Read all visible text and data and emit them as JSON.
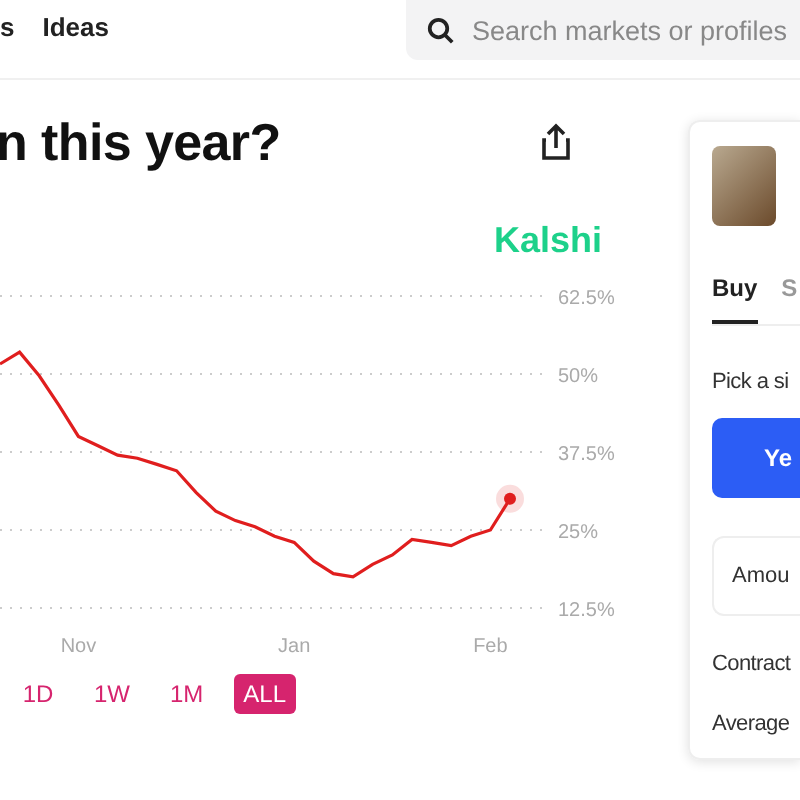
{
  "nav": {
    "items": [
      {
        "label": "s"
      },
      {
        "label": "Ideas"
      }
    ]
  },
  "search": {
    "placeholder": "Search markets or profiles"
  },
  "market": {
    "title": "n this year?",
    "source": "Kalshi",
    "chart_data": {
      "type": "line",
      "categories": [
        null,
        null,
        null,
        null,
        "Nov",
        null,
        null,
        null,
        null,
        null,
        null,
        null,
        null,
        null,
        null,
        "Jan",
        null,
        null,
        null,
        null,
        null,
        null,
        null,
        null,
        null,
        "Feb",
        null
      ],
      "series": [
        {
          "color": "#e01e1e",
          "values": [
            51.6,
            53.5,
            49.7,
            45,
            40,
            38.5,
            37,
            36.5,
            35.5,
            34.5,
            31,
            28,
            26.5,
            25.5,
            24,
            23,
            20,
            18,
            17.5,
            19.5,
            21,
            23.5,
            23,
            22.5,
            24,
            25,
            30
          ]
        }
      ],
      "yticks": [
        {
          "value": 12.5,
          "label": "12.5%"
        },
        {
          "value": 25,
          "label": "25%"
        },
        {
          "value": 37.5,
          "label": "37.5%"
        },
        {
          "value": 50,
          "label": "50%"
        },
        {
          "value": 62.5,
          "label": "62.5%"
        }
      ],
      "ylim": [
        12.5,
        62.5
      ],
      "grid": true
    },
    "ranges": [
      {
        "label": "1D",
        "selected": false
      },
      {
        "label": "1W",
        "selected": false
      },
      {
        "label": "1M",
        "selected": false
      },
      {
        "label": "ALL",
        "selected": true
      }
    ]
  },
  "order": {
    "tabs": [
      {
        "label": "Buy",
        "selected": true
      },
      {
        "label": "S",
        "selected": false
      }
    ],
    "prompt": "Pick a si",
    "yes_button": "Ye",
    "amount_placeholder": "Amou",
    "rows": [
      "Contract",
      "Average"
    ]
  }
}
